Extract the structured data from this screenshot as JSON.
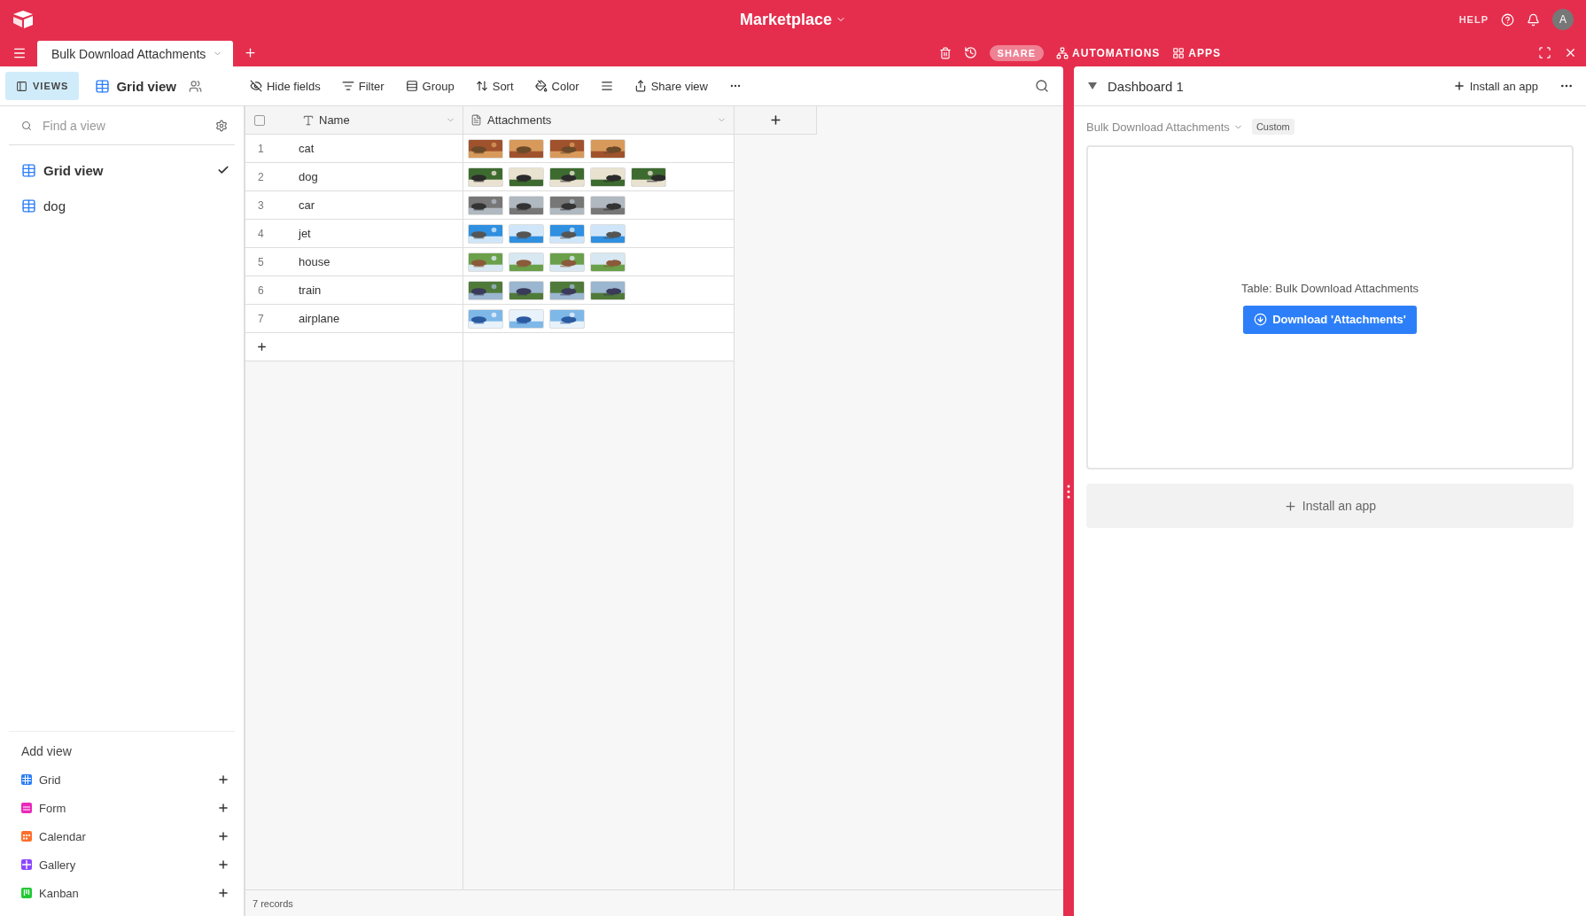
{
  "app_bar": {
    "title": "Marketplace",
    "help": "HELP",
    "avatar": "A"
  },
  "tab_bar": {
    "tabs": [
      {
        "label": "Bulk Download Attachments",
        "selected": true
      }
    ],
    "share": "SHARE",
    "automations": "AUTOMATIONS",
    "apps": "APPS"
  },
  "toolbar": {
    "views_button": {
      "label": "VIEWS",
      "selected": true
    },
    "current_view": "Grid view",
    "actions": [
      {
        "kind": "hide",
        "label": "Hide fields"
      },
      {
        "kind": "filter",
        "label": "Filter"
      },
      {
        "kind": "group",
        "label": "Group"
      },
      {
        "kind": "sort",
        "label": "Sort"
      },
      {
        "kind": "color",
        "label": "Color"
      },
      {
        "kind": "height"
      },
      {
        "kind": "share",
        "label": "Share view"
      },
      {
        "kind": "more"
      }
    ]
  },
  "sidebar": {
    "search": {
      "placeholder": "Find a view"
    },
    "views": [
      {
        "label": "Grid view",
        "selected": true
      },
      {
        "label": "dog",
        "selected": false
      }
    ],
    "add_view": {
      "title": "Add view",
      "items": [
        {
          "kind": "grid",
          "label": "Grid",
          "color": "#2d7ff9"
        },
        {
          "kind": "form",
          "label": "Form",
          "color": "#e929ba"
        },
        {
          "kind": "calendar",
          "label": "Calendar",
          "color": "#ff6f2c"
        },
        {
          "kind": "gallery",
          "label": "Gallery",
          "color": "#8b46ff"
        },
        {
          "kind": "kanban",
          "label": "Kanban",
          "color": "#20c933"
        }
      ]
    }
  },
  "table": {
    "select_all": {
      "checked": false
    },
    "columns": [
      "Name",
      "Attachments"
    ],
    "rows": [
      {
        "number": "1",
        "name": "cat"
      },
      {
        "number": "2",
        "name": "dog"
      },
      {
        "number": "3",
        "name": "car"
      },
      {
        "number": "4",
        "name": "jet"
      },
      {
        "number": "5",
        "name": "house"
      },
      {
        "number": "6",
        "name": "train"
      },
      {
        "number": "7",
        "name": "airplane"
      }
    ],
    "footer": "7 records"
  },
  "dashboard": {
    "title": "Dashboard 1",
    "install_link": "Install an app",
    "table_picker": "Bulk Download Attachments",
    "badge": "Custom",
    "app_caption": "Table: Bulk Download Attachments",
    "download_button": "Download 'Attachments'",
    "install_block": "Install an app"
  }
}
